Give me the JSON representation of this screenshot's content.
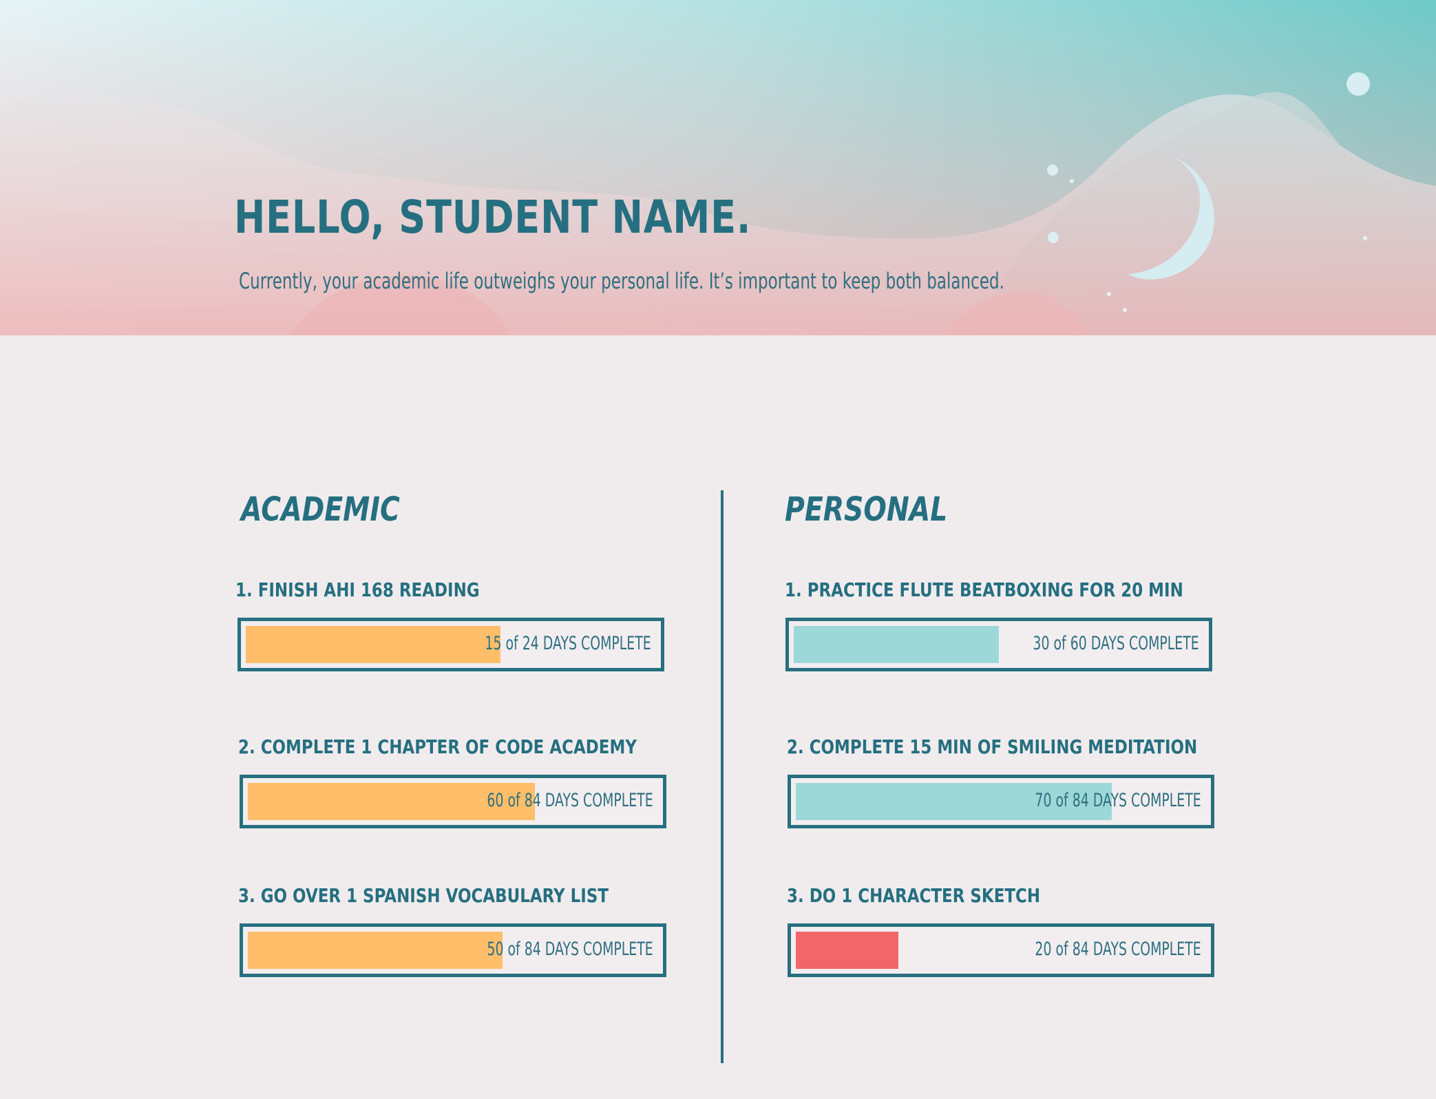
{
  "header": {
    "greeting": "HELLO, STUDENT NAME.",
    "subtitle": "Currently, your academic life outweighs your personal life. It’s important to keep both balanced."
  },
  "colors": {
    "primary": "#256f80",
    "academic_fill": "#ffbe6a",
    "personal_fill": "#9dd8d8",
    "warning_fill": "#f2666a",
    "background": "#f0ecee"
  },
  "academic": {
    "title": "ACADEMIC",
    "goals": [
      {
        "label": "1. FINISH AHI 168  READING",
        "status": "15 of 24 DAYS COMPLETE",
        "progress": 0.62
      },
      {
        "label": "2. COMPLETE 1 CHAPTER OF CODE ACADEMY",
        "status": "60 of 84 DAYS COMPLETE",
        "progress": 0.7
      },
      {
        "label": "3. GO OVER 1 SPANISH VOCABULARY LIST",
        "status": "50 of 84 DAYS COMPLETE",
        "progress": 0.62
      }
    ]
  },
  "personal": {
    "title": "PERSONAL",
    "goals": [
      {
        "label": "1. PRACTICE FLUTE BEATBOXING FOR 20 MIN",
        "status": "30 of 60 DAYS COMPLETE",
        "progress": 0.5
      },
      {
        "label": "2. COMPLETE 15 MIN OF SMILING MEDITATION",
        "status": "70 of 84 DAYS COMPLETE",
        "progress": 0.77
      },
      {
        "label": "3. DO 1 CHARACTER SKETCH",
        "status": "20 of 84 DAYS COMPLETE",
        "progress": 0.25
      }
    ]
  }
}
